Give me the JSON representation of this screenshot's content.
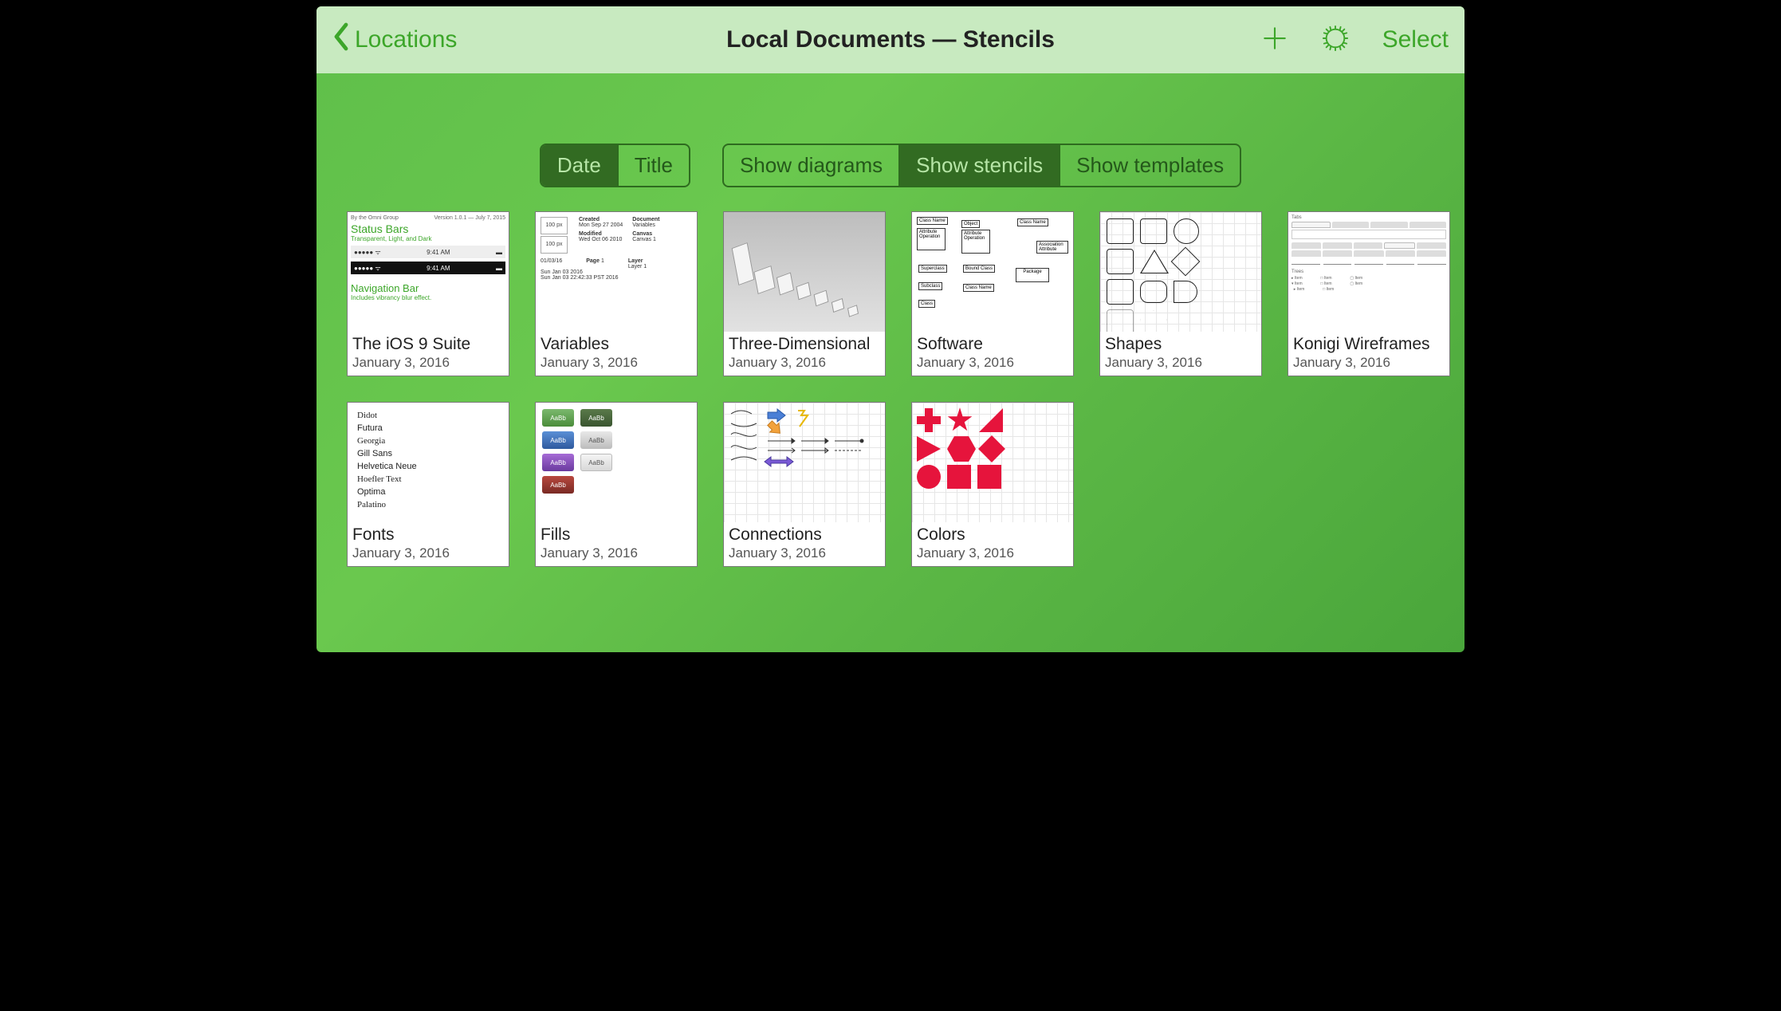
{
  "navbar": {
    "back_label": "Locations",
    "title": "Local Documents — Stencils",
    "select_label": "Select"
  },
  "sort": {
    "options": [
      "Date",
      "Title"
    ],
    "active_index": 0
  },
  "filter": {
    "options": [
      "Show diagrams",
      "Show stencils",
      "Show templates"
    ],
    "active_index": 1
  },
  "documents": [
    {
      "title": "The iOS 9 Suite",
      "date": "January 3, 2016"
    },
    {
      "title": "Variables",
      "date": "January 3, 2016"
    },
    {
      "title": "Three-Dimensional",
      "date": "January 3, 2016"
    },
    {
      "title": "Software",
      "date": "January 3, 2016"
    },
    {
      "title": "Shapes",
      "date": "January 3, 2016"
    },
    {
      "title": "Konigi Wireframes",
      "date": "January 3, 2016"
    },
    {
      "title": "Fonts",
      "date": "January 3, 2016"
    },
    {
      "title": "Fills",
      "date": "January 3, 2016"
    },
    {
      "title": "Connections",
      "date": "January 3, 2016"
    },
    {
      "title": "Colors",
      "date": "January 3, 2016"
    }
  ],
  "thumbs": {
    "ios": {
      "byline": "By the Omni Group",
      "version": "Version 1.0.1 — July 7, 2015",
      "h1": "Status Bars",
      "sub1": "Transparent, Light, and Dark",
      "time": "9:41 AM",
      "h2": "Navigation Bar",
      "sub2": "Includes vibrancy blur effect."
    },
    "vars": {
      "created_l": "Created",
      "created_v": "Mon Sep 27 2004",
      "modified_l": "Modified",
      "modified_v": "Wed Oct 06 2010",
      "doc_l": "Document",
      "doc_v": "Variables",
      "canvas_l": "Canvas",
      "canvas_v": "Canvas 1",
      "page_l": "Page",
      "page_v": "1",
      "layer_l": "Layer",
      "layer_v": "Layer 1",
      "d1": "01/03/16",
      "d2": "Sun Jan 03 2016",
      "d3": "Sun Jan 03 22:42:33 PST 2016",
      "px": "100 px"
    },
    "fonts": [
      "Didot",
      "Futura",
      "Georgia",
      "Gill Sans",
      "Helvetica Neue",
      "Hoefler Text",
      "Optima",
      "Palatino"
    ],
    "fills_label": "AaBb",
    "konigi": {
      "h1": "Tabs",
      "h2": "Trees"
    },
    "uml": {
      "class_name": "Class Name",
      "object": "Object",
      "attribute": "Attribute",
      "operation": "Operation",
      "superclass": "Superclass",
      "subclass": "Subclass",
      "bound": "Bound Class",
      "package": "Package",
      "assoc": "Association",
      "class": "Class"
    }
  }
}
